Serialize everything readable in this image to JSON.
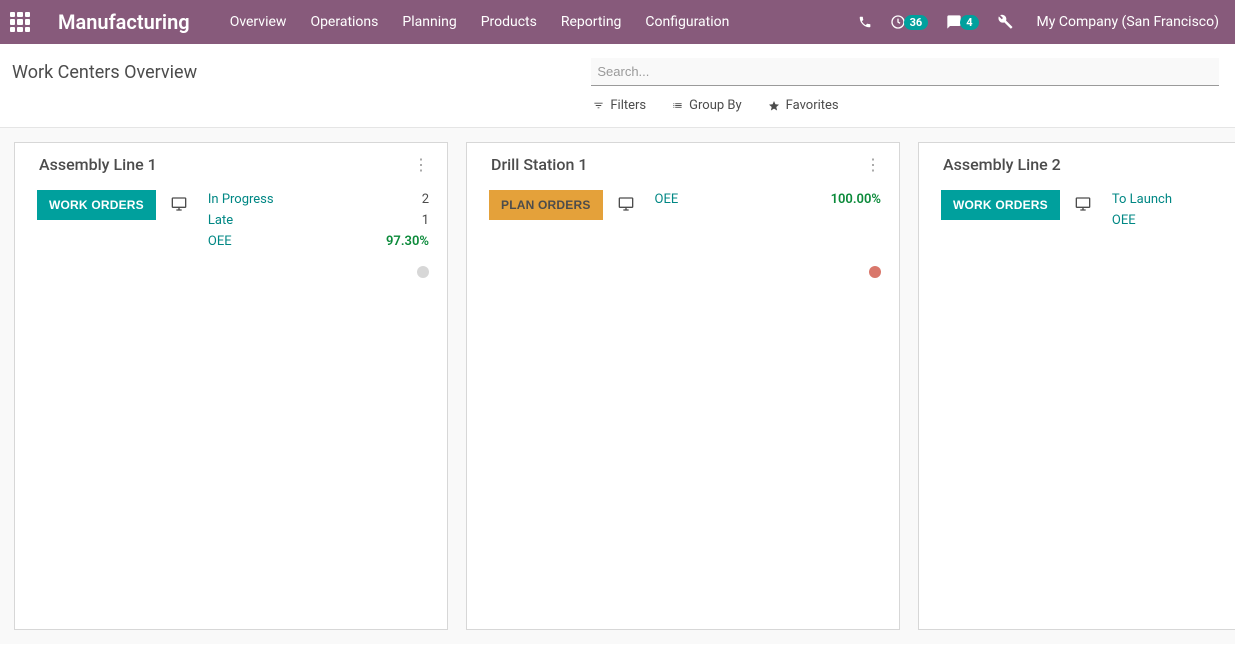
{
  "header": {
    "app_title": "Manufacturing",
    "menu": [
      "Overview",
      "Operations",
      "Planning",
      "Products",
      "Reporting",
      "Configuration"
    ],
    "activities_badge": "36",
    "messages_badge": "4",
    "company": "My Company (San Francisco)"
  },
  "subheader": {
    "page_title": "Work Centers Overview",
    "search_placeholder": "Search...",
    "filters_label": "Filters",
    "groupby_label": "Group By",
    "favorites_label": "Favorites"
  },
  "cards": [
    {
      "title": "Assembly Line 1",
      "button_label": "WORK ORDERS",
      "button_style": "teal",
      "stats": [
        {
          "label": "In Progress",
          "value": "2",
          "green": false
        },
        {
          "label": "Late",
          "value": "1",
          "green": false
        },
        {
          "label": "OEE",
          "value": "97.30%",
          "green": true
        }
      ],
      "dot": "grey"
    },
    {
      "title": "Drill Station 1",
      "button_label": "PLAN ORDERS",
      "button_style": "orange",
      "stats": [
        {
          "label": "OEE",
          "value": "100.00%",
          "green": true
        }
      ],
      "dot": "red"
    },
    {
      "title": "Assembly Line 2",
      "button_label": "WORK ORDERS",
      "button_style": "teal",
      "stats": [
        {
          "label": "To Launch",
          "value": "",
          "green": false
        },
        {
          "label": "OEE",
          "value": "",
          "green": false
        }
      ],
      "dot": null
    }
  ]
}
